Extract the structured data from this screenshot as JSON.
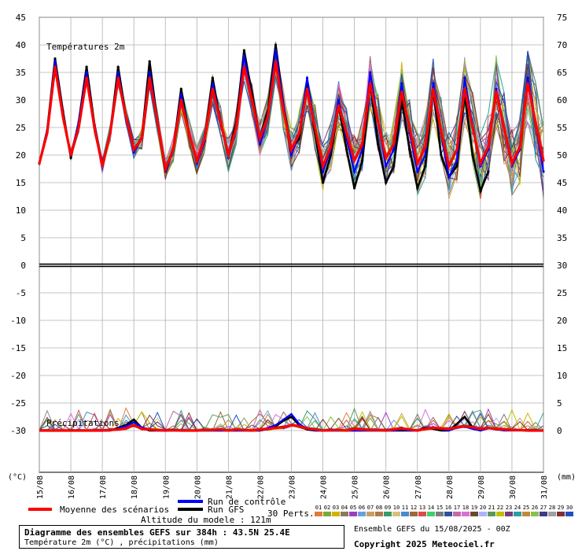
{
  "chart_data": {
    "type": "line",
    "title": "Diagramme des ensembles GEFS sur 384h : 43.5N 25.4E",
    "subtitle": "Température 2m (°C) , précipitations (mm)",
    "x_labels": [
      "15/08",
      "16/08",
      "17/08",
      "18/08",
      "19/08",
      "20/08",
      "21/08",
      "22/08",
      "23/08",
      "24/08",
      "25/08",
      "26/08",
      "27/08",
      "28/08",
      "29/08",
      "30/08",
      "31/08"
    ],
    "x_unit_left": "(°C)",
    "x_unit_right": "(mm)",
    "left_axis": {
      "ylim": [
        -35,
        45
      ],
      "ticks": [
        45,
        40,
        35,
        30,
        25,
        20,
        15,
        10,
        5,
        0,
        -5,
        -10,
        -15,
        -20,
        -25,
        -30
      ]
    },
    "right_axis": {
      "ticks": [
        75,
        70,
        65,
        60,
        55,
        50,
        45,
        40,
        35,
        30,
        25,
        20,
        15,
        10,
        5,
        0
      ]
    },
    "panels": {
      "temperature": {
        "label": "Températures 2m",
        "ylim_c": [
          0,
          45
        ]
      },
      "precipitation": {
        "label": "Précipitations",
        "baseline_c": -30,
        "scale_mm": [
          0,
          25
        ]
      }
    },
    "grid": true,
    "step_hours": 6,
    "series": [
      {
        "name": "Moyenne des scénarios",
        "color": "#ff0000",
        "kind": "mean",
        "temp": [
          18.5,
          24.0,
          36.0,
          27.0,
          20.0,
          25.0,
          34.0,
          25.0,
          18.0,
          24.0,
          34.0,
          27.0,
          21.0,
          23.0,
          34.0,
          26.0,
          17.5,
          21.0,
          30.0,
          24.0,
          19.0,
          23.0,
          32.0,
          26.0,
          20.0,
          25.0,
          36.0,
          30.0,
          23.0,
          27.0,
          37.0,
          28.0,
          21.0,
          24.0,
          32.0,
          25.0,
          18.0,
          21.5,
          29.0,
          24.0,
          19.0,
          22.0,
          33.0,
          26.0,
          19.5,
          22.0,
          31.5,
          25.0,
          18.5,
          21.5,
          32.0,
          24.5,
          18.0,
          21.0,
          32.0,
          25.0,
          18.5,
          21.5,
          31.5,
          25.0,
          18.5,
          21.5,
          33.0,
          26.0,
          19.0
        ],
        "precip": [
          0,
          0,
          0,
          0,
          0,
          0,
          0,
          0,
          0,
          0.1,
          0.2,
          0.4,
          1.0,
          0.3,
          0.2,
          0.1,
          0,
          0.1,
          0,
          0,
          0,
          0.1,
          0.1,
          0.2,
          0,
          0.2,
          0.1,
          0,
          0.2,
          0.3,
          0.5,
          0.6,
          1.0,
          0.8,
          0.4,
          0.2,
          0,
          0.1,
          0.1,
          0,
          0.3,
          0.2,
          0.1,
          0.1,
          0,
          0.2,
          0.4,
          0.2,
          0,
          0.3,
          0.5,
          0.4,
          0.3,
          0.6,
          0.8,
          0.6,
          0.3,
          0.5,
          0.3,
          0.2,
          0.1,
          0.1,
          0,
          0,
          0
        ]
      },
      {
        "name": "Run de contrôle",
        "color": "#0000ff",
        "kind": "control",
        "temp": [
          18.5,
          24.5,
          37.0,
          27.5,
          20.0,
          26.0,
          35.0,
          25.0,
          18.5,
          24.0,
          35.0,
          27.0,
          20.5,
          23.0,
          35.0,
          26.5,
          17.0,
          21.0,
          31.0,
          24.0,
          18.5,
          22.5,
          33.0,
          26.0,
          19.5,
          25.0,
          38.0,
          30.0,
          22.0,
          27.0,
          39.0,
          29.0,
          20.0,
          24.0,
          34.0,
          25.0,
          17.0,
          21.0,
          30.0,
          23.0,
          17.0,
          21.0,
          35.0,
          26.0,
          18.0,
          21.0,
          33.0,
          24.0,
          17.0,
          20.0,
          33.0,
          24.0,
          16.0,
          19.0,
          34.0,
          25.0,
          18.0,
          21.0,
          32.0,
          25.0,
          18.0,
          21.0,
          34.0,
          26.0,
          17.0
        ],
        "precip": [
          0,
          0,
          0,
          0,
          0,
          0,
          0,
          0,
          0,
          0,
          0.4,
          0.8,
          1.5,
          0.6,
          0.2,
          0,
          0,
          0,
          0,
          0,
          0,
          0,
          0,
          0,
          0,
          0,
          0,
          0,
          0,
          0.5,
          1.0,
          2.0,
          3.0,
          1.2,
          0.3,
          0,
          0,
          0,
          0,
          0,
          0,
          0,
          0,
          0,
          0,
          0,
          0.2,
          0,
          0,
          0.4,
          0.6,
          0.3,
          0,
          0.5,
          0.7,
          0.3,
          0,
          0.4,
          0.2,
          0,
          0,
          0,
          0,
          0,
          0
        ]
      },
      {
        "name": "Run GFS",
        "color": "#000000",
        "kind": "gfs",
        "temp": [
          18.5,
          24.5,
          37.5,
          28.0,
          19.5,
          26.0,
          36.0,
          25.5,
          18.0,
          24.0,
          36.0,
          27.0,
          21.0,
          23.0,
          37.0,
          26.0,
          17.0,
          21.0,
          32.0,
          24.0,
          19.0,
          23.0,
          34.0,
          26.0,
          20.0,
          26.0,
          39.0,
          31.0,
          23.0,
          28.0,
          40.0,
          29.0,
          21.0,
          23.0,
          33.0,
          24.0,
          15.0,
          20.0,
          29.0,
          21.0,
          14.0,
          19.0,
          33.0,
          22.0,
          15.0,
          18.0,
          30.0,
          21.0,
          14.0,
          18.0,
          32.0,
          20.0,
          16.0,
          18.0,
          31.0,
          20.0,
          13.5,
          17.0
        ],
        "precip": [
          0,
          0,
          0,
          0,
          0,
          0,
          0,
          0,
          0,
          0,
          0.5,
          1.0,
          2.0,
          0.5,
          0,
          0,
          0,
          0,
          0,
          0,
          0,
          0,
          0,
          0,
          0,
          0,
          0,
          0,
          0,
          0.3,
          0.8,
          1.8,
          2.5,
          1.0,
          0.2,
          0,
          0,
          0,
          0,
          0,
          0,
          0,
          0,
          0,
          0,
          0,
          0,
          0,
          0,
          0.5,
          0.3,
          0,
          0,
          1.2,
          2.5,
          0.5,
          0,
          0.6
        ]
      }
    ]
  },
  "legend": {
    "mean_label": "Moyenne des scénarios",
    "control_label": "Run de contrôle",
    "gfs_label": "Run GFS",
    "perts_label": "30 Perts.",
    "pert_numbers": [
      "01",
      "02",
      "03",
      "04",
      "05",
      "06",
      "07",
      "08",
      "09",
      "10",
      "11",
      "12",
      "13",
      "14",
      "15",
      "16",
      "17",
      "18",
      "19",
      "20",
      "21",
      "22",
      "23",
      "24",
      "25",
      "26",
      "27",
      "28",
      "29",
      "30"
    ],
    "pert_colors": [
      "#e07b39",
      "#7aa83b",
      "#d4b000",
      "#8a7b5a",
      "#9b3fc2",
      "#6aa0d8",
      "#c8a060",
      "#b07a45",
      "#3a9a6a",
      "#d8c27a",
      "#4a8ad0",
      "#9b6a3a",
      "#e04a4a",
      "#3fcf6f",
      "#7c7c7c",
      "#2f4fa0",
      "#c46aa6",
      "#d870d8",
      "#6a4a2a",
      "#b0b0ff",
      "#5a9a5a",
      "#c0c000",
      "#7a3a7a",
      "#2aa0a0",
      "#c08a3a",
      "#8ac050",
      "#403a8a",
      "#a0a0a0",
      "#803030",
      "#2050c0"
    ]
  },
  "footer": {
    "altitude": "Altitude du modele : 121m",
    "title": "Diagramme des ensembles GEFS sur 384h : 43.5N 25.4E",
    "subtitle": "Température 2m (°C) , précipitations (mm)",
    "run_info": "Ensemble GEFS du 15/08/2025 - 00Z",
    "copyright": "Copyright 2025 Meteociel.fr"
  }
}
